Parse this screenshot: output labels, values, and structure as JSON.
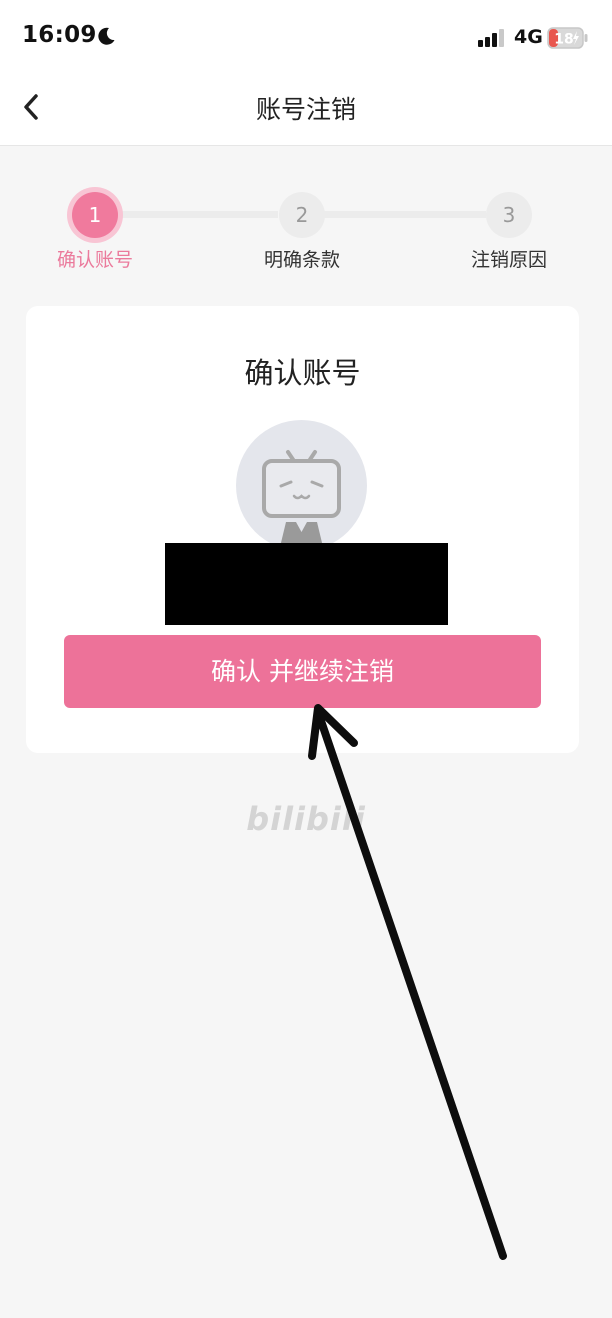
{
  "status_bar": {
    "time": "16:09",
    "network": "4G",
    "battery": "18"
  },
  "nav": {
    "title": "账号注销",
    "back_icon": "chevron-left-icon"
  },
  "steps": [
    {
      "number": "1",
      "label": "确认账号",
      "active": true
    },
    {
      "number": "2",
      "label": "明确条款",
      "active": false
    },
    {
      "number": "3",
      "label": "注销原因",
      "active": false
    }
  ],
  "card": {
    "title": "确认账号",
    "avatar_icon": "default-tv-avatar-icon",
    "confirm_button_label": "确认 并继续注销"
  },
  "brand": {
    "logo_text": "bilibili"
  },
  "colors": {
    "accent": "#ed7299",
    "accent_light": "#f8c5d4",
    "battery_low": "#e8574f"
  }
}
